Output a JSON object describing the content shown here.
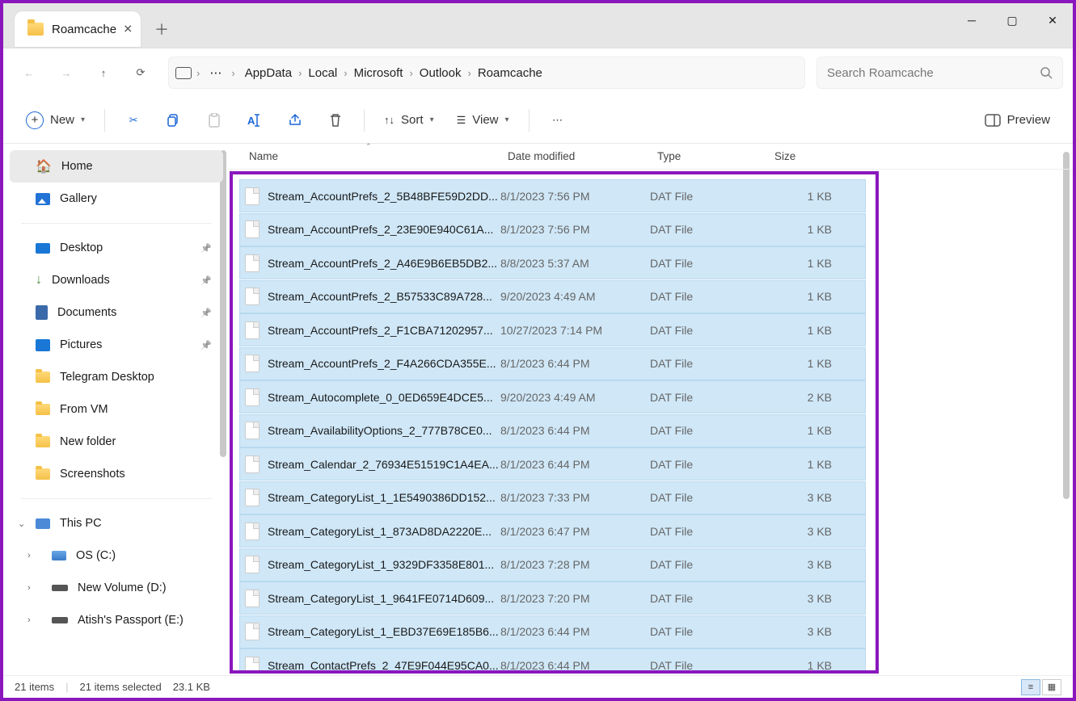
{
  "window": {
    "title": "Roamcache"
  },
  "breadcrumbs": [
    "AppData",
    "Local",
    "Microsoft",
    "Outlook",
    "Roamcache"
  ],
  "search": {
    "placeholder": "Search Roamcache"
  },
  "toolbar": {
    "new": "New",
    "sort": "Sort",
    "view": "View",
    "preview": "Preview"
  },
  "sidebar": {
    "home": "Home",
    "gallery": "Gallery",
    "quick": [
      {
        "label": "Desktop",
        "pinned": true,
        "icon": "desktop"
      },
      {
        "label": "Downloads",
        "pinned": true,
        "icon": "dl"
      },
      {
        "label": "Documents",
        "pinned": true,
        "icon": "doc"
      },
      {
        "label": "Pictures",
        "pinned": true,
        "icon": "pic"
      },
      {
        "label": "Telegram Desktop",
        "pinned": false,
        "icon": "folder"
      },
      {
        "label": "From VM",
        "pinned": false,
        "icon": "folder"
      },
      {
        "label": "New folder",
        "pinned": false,
        "icon": "folder"
      },
      {
        "label": "Screenshots",
        "pinned": false,
        "icon": "folder"
      }
    ],
    "thispc": "This PC",
    "drives": [
      "OS (C:)",
      "New Volume (D:)",
      "Atish's Passport  (E:)"
    ]
  },
  "columns": {
    "name": "Name",
    "date": "Date modified",
    "type": "Type",
    "size": "Size"
  },
  "files": [
    {
      "name": "Stream_AccountPrefs_2_5B48BFE59D2DD...",
      "date": "8/1/2023 7:56 PM",
      "type": "DAT File",
      "size": "1 KB"
    },
    {
      "name": "Stream_AccountPrefs_2_23E90E940C61A...",
      "date": "8/1/2023 7:56 PM",
      "type": "DAT File",
      "size": "1 KB"
    },
    {
      "name": "Stream_AccountPrefs_2_A46E9B6EB5DB2...",
      "date": "8/8/2023 5:37 AM",
      "type": "DAT File",
      "size": "1 KB"
    },
    {
      "name": "Stream_AccountPrefs_2_B57533C89A728...",
      "date": "9/20/2023 4:49 AM",
      "type": "DAT File",
      "size": "1 KB"
    },
    {
      "name": "Stream_AccountPrefs_2_F1CBA71202957...",
      "date": "10/27/2023 7:14 PM",
      "type": "DAT File",
      "size": "1 KB"
    },
    {
      "name": "Stream_AccountPrefs_2_F4A266CDA355E...",
      "date": "8/1/2023 6:44 PM",
      "type": "DAT File",
      "size": "1 KB"
    },
    {
      "name": "Stream_Autocomplete_0_0ED659E4DCE5...",
      "date": "9/20/2023 4:49 AM",
      "type": "DAT File",
      "size": "2 KB"
    },
    {
      "name": "Stream_AvailabilityOptions_2_777B78CE0...",
      "date": "8/1/2023 6:44 PM",
      "type": "DAT File",
      "size": "1 KB"
    },
    {
      "name": "Stream_Calendar_2_76934E51519C1A4EA...",
      "date": "8/1/2023 6:44 PM",
      "type": "DAT File",
      "size": "1 KB"
    },
    {
      "name": "Stream_CategoryList_1_1E5490386DD152...",
      "date": "8/1/2023 7:33 PM",
      "type": "DAT File",
      "size": "3 KB"
    },
    {
      "name": "Stream_CategoryList_1_873AD8DA2220E...",
      "date": "8/1/2023 6:47 PM",
      "type": "DAT File",
      "size": "3 KB"
    },
    {
      "name": "Stream_CategoryList_1_9329DF3358E801...",
      "date": "8/1/2023 7:28 PM",
      "type": "DAT File",
      "size": "3 KB"
    },
    {
      "name": "Stream_CategoryList_1_9641FE0714D609...",
      "date": "8/1/2023 7:20 PM",
      "type": "DAT File",
      "size": "3 KB"
    },
    {
      "name": "Stream_CategoryList_1_EBD37E69E185B6...",
      "date": "8/1/2023 6:44 PM",
      "type": "DAT File",
      "size": "3 KB"
    },
    {
      "name": "Stream_ContactPrefs_2_47E9F044E95CA0...",
      "date": "8/1/2023 6:44 PM",
      "type": "DAT File",
      "size": "1 KB"
    }
  ],
  "status": {
    "count": "21 items",
    "selected": "21 items selected",
    "size": "23.1 KB"
  }
}
